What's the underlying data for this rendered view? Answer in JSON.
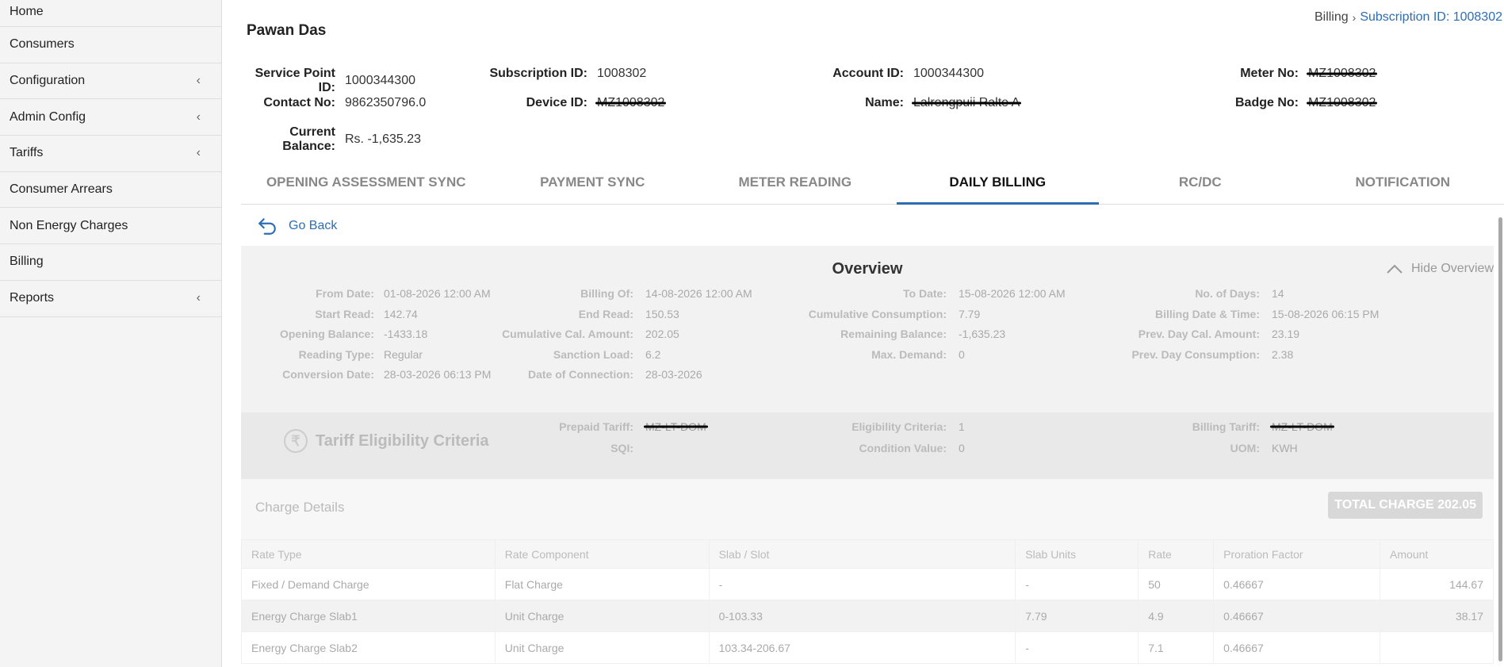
{
  "sidebar": {
    "items": [
      {
        "label": "Home",
        "has_submenu": false
      },
      {
        "label": "Consumers",
        "has_submenu": false
      },
      {
        "label": "Configuration",
        "has_submenu": true
      },
      {
        "label": "Admin Config",
        "has_submenu": true
      },
      {
        "label": "Tariffs",
        "has_submenu": true
      },
      {
        "label": "Consumer Arrears",
        "has_submenu": false
      },
      {
        "label": "Non Energy Charges",
        "has_submenu": false
      },
      {
        "label": "Billing",
        "has_submenu": false
      },
      {
        "label": "Reports",
        "has_submenu": true
      }
    ],
    "chevron": "‹"
  },
  "breadcrumb": {
    "root": "Billing",
    "current": "Subscription ID: 1008302"
  },
  "consumer": {
    "name": "Pawan Das",
    "service_point_label": "Service Point ID:",
    "service_point": "1000344300",
    "subscription_label": "Subscription ID:",
    "subscription": "1008302",
    "account_label": "Account ID:",
    "account": "1000344300",
    "meter_label": "Meter No:",
    "meter": "MZ1008302",
    "contact_label": "Contact No:",
    "contact": "9862350796.0",
    "device_label": "Device ID:",
    "device": "MZ1008302",
    "name_label": "Name:",
    "name_value": "Lalrengpuii Ralte A",
    "badge_label": "Badge No:",
    "badge": "MZ1008302",
    "balance_label": "Current Balance:",
    "balance": "Rs. -1,635.23"
  },
  "tabs": [
    {
      "label": "OPENING ASSESSMENT SYNC",
      "active": false
    },
    {
      "label": "PAYMENT SYNC",
      "active": false
    },
    {
      "label": "METER READING",
      "active": false
    },
    {
      "label": "DAILY BILLING",
      "active": true
    },
    {
      "label": "RC/DC",
      "active": false
    },
    {
      "label": "NOTIFICATION",
      "active": false
    }
  ],
  "go_back": "Go Back",
  "overview": {
    "title": "Overview",
    "hide_label": "Hide Overview",
    "fields": [
      {
        "label": "From Date:",
        "value": "01-08-2026 12:00 AM"
      },
      {
        "label": "Billing Of:",
        "value": "14-08-2026 12:00 AM"
      },
      {
        "label": "To Date:",
        "value": "15-08-2026 12:00 AM"
      },
      {
        "label": "No. of Days:",
        "value": "14"
      },
      {
        "label": "Start Read:",
        "value": "142.74"
      },
      {
        "label": "End Read:",
        "value": "150.53"
      },
      {
        "label": "Cumulative Consumption:",
        "value": "7.79"
      },
      {
        "label": "Billing Date & Time:",
        "value": "15-08-2026 06:15 PM"
      },
      {
        "label": "Opening Balance:",
        "value": "-1433.18"
      },
      {
        "label": "Cumulative Cal. Amount:",
        "value": "202.05"
      },
      {
        "label": "Remaining Balance:",
        "value": "-1,635.23"
      },
      {
        "label": "Prev. Day Cal. Amount:",
        "value": "23.19"
      },
      {
        "label": "Reading Type:",
        "value": "Regular"
      },
      {
        "label": "Sanction Load:",
        "value": "6.2"
      },
      {
        "label": "Max. Demand:",
        "value": "0"
      },
      {
        "label": "Prev. Day Consumption:",
        "value": "2.38"
      },
      {
        "label": "Conversion Date:",
        "value": "28-03-2026 06:13 PM"
      },
      {
        "label": "Date of Connection:",
        "value": "28-03-2026"
      }
    ]
  },
  "tariff": {
    "title": "Tariff Eligibility Criteria",
    "currency_icon": "₹",
    "fields": [
      {
        "label": "Prepaid Tariff:",
        "value": "MZ-LT-DOM",
        "redacted": true
      },
      {
        "label": "Eligibility Criteria:",
        "value": "1",
        "redacted": false
      },
      {
        "label": "Billing Tariff:",
        "value": "MZ-LT-DOM",
        "redacted": true
      },
      {
        "label": "SQI:",
        "value": "",
        "redacted": false
      },
      {
        "label": "Condition Value:",
        "value": "0",
        "redacted": false
      },
      {
        "label": "UOM:",
        "value": "KWH",
        "redacted": false
      }
    ]
  },
  "charges": {
    "title": "Charge Details",
    "total_label": "TOTAL CHARGE 202.05",
    "columns": [
      "Rate Type",
      "Rate Component",
      "Slab / Slot",
      "Slab Units",
      "Rate",
      "Proration Factor",
      "Amount"
    ],
    "rows": [
      [
        "Fixed / Demand Charge",
        "Flat Charge",
        "-",
        "-",
        "50",
        "0.46667",
        "144.67"
      ],
      [
        "Energy Charge Slab1",
        "Unit Charge",
        "0-103.33",
        "7.79",
        "4.9",
        "0.46667",
        "38.17"
      ],
      [
        "Energy Charge Slab2",
        "Unit Charge",
        "103.34-206.67",
        "-",
        "7.1",
        "0.46667",
        ""
      ]
    ]
  },
  "colors": {
    "accent": "#2d6db5",
    "sidebar_bg": "#f4f4f4"
  }
}
